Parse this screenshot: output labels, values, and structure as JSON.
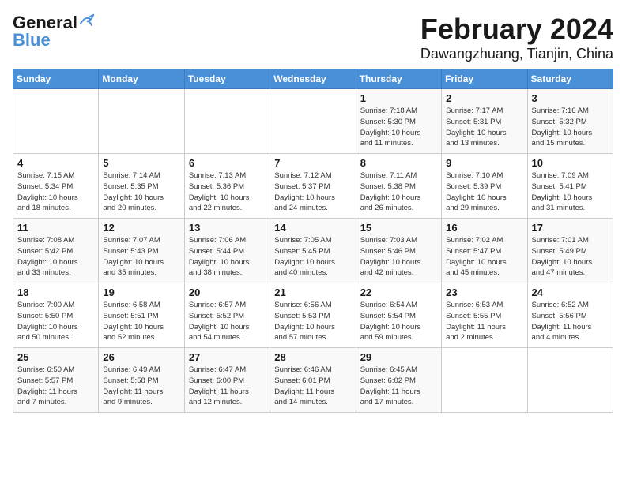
{
  "logo": {
    "line1": "General",
    "line2": "Blue",
    "bird_symbol": "▲"
  },
  "title": {
    "month_year": "February 2024",
    "location": "Dawangzhuang, Tianjin, China"
  },
  "header_days": [
    "Sunday",
    "Monday",
    "Tuesday",
    "Wednesday",
    "Thursday",
    "Friday",
    "Saturday"
  ],
  "weeks": [
    [
      {
        "day": "",
        "info": ""
      },
      {
        "day": "",
        "info": ""
      },
      {
        "day": "",
        "info": ""
      },
      {
        "day": "",
        "info": ""
      },
      {
        "day": "1",
        "info": "Sunrise: 7:18 AM\nSunset: 5:30 PM\nDaylight: 10 hours\nand 11 minutes."
      },
      {
        "day": "2",
        "info": "Sunrise: 7:17 AM\nSunset: 5:31 PM\nDaylight: 10 hours\nand 13 minutes."
      },
      {
        "day": "3",
        "info": "Sunrise: 7:16 AM\nSunset: 5:32 PM\nDaylight: 10 hours\nand 15 minutes."
      }
    ],
    [
      {
        "day": "4",
        "info": "Sunrise: 7:15 AM\nSunset: 5:34 PM\nDaylight: 10 hours\nand 18 minutes."
      },
      {
        "day": "5",
        "info": "Sunrise: 7:14 AM\nSunset: 5:35 PM\nDaylight: 10 hours\nand 20 minutes."
      },
      {
        "day": "6",
        "info": "Sunrise: 7:13 AM\nSunset: 5:36 PM\nDaylight: 10 hours\nand 22 minutes."
      },
      {
        "day": "7",
        "info": "Sunrise: 7:12 AM\nSunset: 5:37 PM\nDaylight: 10 hours\nand 24 minutes."
      },
      {
        "day": "8",
        "info": "Sunrise: 7:11 AM\nSunset: 5:38 PM\nDaylight: 10 hours\nand 26 minutes."
      },
      {
        "day": "9",
        "info": "Sunrise: 7:10 AM\nSunset: 5:39 PM\nDaylight: 10 hours\nand 29 minutes."
      },
      {
        "day": "10",
        "info": "Sunrise: 7:09 AM\nSunset: 5:41 PM\nDaylight: 10 hours\nand 31 minutes."
      }
    ],
    [
      {
        "day": "11",
        "info": "Sunrise: 7:08 AM\nSunset: 5:42 PM\nDaylight: 10 hours\nand 33 minutes."
      },
      {
        "day": "12",
        "info": "Sunrise: 7:07 AM\nSunset: 5:43 PM\nDaylight: 10 hours\nand 35 minutes."
      },
      {
        "day": "13",
        "info": "Sunrise: 7:06 AM\nSunset: 5:44 PM\nDaylight: 10 hours\nand 38 minutes."
      },
      {
        "day": "14",
        "info": "Sunrise: 7:05 AM\nSunset: 5:45 PM\nDaylight: 10 hours\nand 40 minutes."
      },
      {
        "day": "15",
        "info": "Sunrise: 7:03 AM\nSunset: 5:46 PM\nDaylight: 10 hours\nand 42 minutes."
      },
      {
        "day": "16",
        "info": "Sunrise: 7:02 AM\nSunset: 5:47 PM\nDaylight: 10 hours\nand 45 minutes."
      },
      {
        "day": "17",
        "info": "Sunrise: 7:01 AM\nSunset: 5:49 PM\nDaylight: 10 hours\nand 47 minutes."
      }
    ],
    [
      {
        "day": "18",
        "info": "Sunrise: 7:00 AM\nSunset: 5:50 PM\nDaylight: 10 hours\nand 50 minutes."
      },
      {
        "day": "19",
        "info": "Sunrise: 6:58 AM\nSunset: 5:51 PM\nDaylight: 10 hours\nand 52 minutes."
      },
      {
        "day": "20",
        "info": "Sunrise: 6:57 AM\nSunset: 5:52 PM\nDaylight: 10 hours\nand 54 minutes."
      },
      {
        "day": "21",
        "info": "Sunrise: 6:56 AM\nSunset: 5:53 PM\nDaylight: 10 hours\nand 57 minutes."
      },
      {
        "day": "22",
        "info": "Sunrise: 6:54 AM\nSunset: 5:54 PM\nDaylight: 10 hours\nand 59 minutes."
      },
      {
        "day": "23",
        "info": "Sunrise: 6:53 AM\nSunset: 5:55 PM\nDaylight: 11 hours\nand 2 minutes."
      },
      {
        "day": "24",
        "info": "Sunrise: 6:52 AM\nSunset: 5:56 PM\nDaylight: 11 hours\nand 4 minutes."
      }
    ],
    [
      {
        "day": "25",
        "info": "Sunrise: 6:50 AM\nSunset: 5:57 PM\nDaylight: 11 hours\nand 7 minutes."
      },
      {
        "day": "26",
        "info": "Sunrise: 6:49 AM\nSunset: 5:58 PM\nDaylight: 11 hours\nand 9 minutes."
      },
      {
        "day": "27",
        "info": "Sunrise: 6:47 AM\nSunset: 6:00 PM\nDaylight: 11 hours\nand 12 minutes."
      },
      {
        "day": "28",
        "info": "Sunrise: 6:46 AM\nSunset: 6:01 PM\nDaylight: 11 hours\nand 14 minutes."
      },
      {
        "day": "29",
        "info": "Sunrise: 6:45 AM\nSunset: 6:02 PM\nDaylight: 11 hours\nand 17 minutes."
      },
      {
        "day": "",
        "info": ""
      },
      {
        "day": "",
        "info": ""
      }
    ]
  ]
}
